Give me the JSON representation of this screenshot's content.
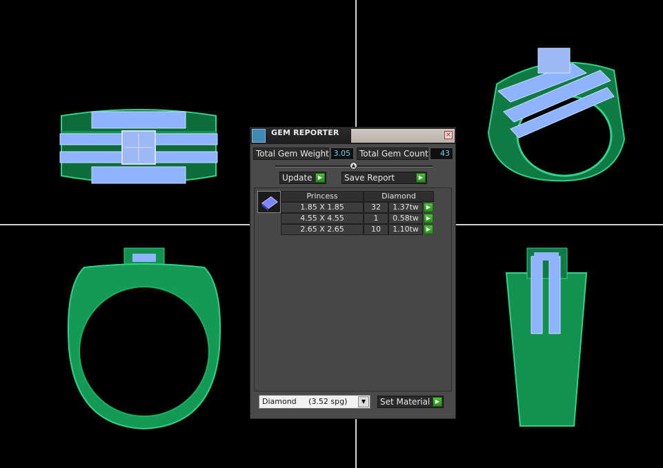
{
  "window": {
    "title": "GEM REPORTER",
    "close_label": "×"
  },
  "totals": {
    "weight_label": "Total Gem Weight",
    "weight_value": "3.05",
    "count_label": "Total Gem Count",
    "count_value": "43"
  },
  "buttons": {
    "update": "Update",
    "save_report": "Save Report",
    "set_material": "Set Material"
  },
  "table": {
    "headers": [
      "Princess",
      "Diamond"
    ],
    "rows": [
      {
        "size": "1.85 X 1.85",
        "count": "32",
        "weight": "1.37tw"
      },
      {
        "size": "4.55 X 4.55",
        "count": "1",
        "weight": "0.58tw"
      },
      {
        "size": "2.65 X 2.65",
        "count": "10",
        "weight": "1.10tw"
      }
    ]
  },
  "material_select": {
    "value": "Diamond     (3.52 spg)"
  },
  "colors": {
    "ring_green": "#1fa060",
    "gem_blue": "#8fb4ff",
    "viewport_bg": "#000000",
    "panel_bg": "#4a4a4a"
  },
  "icons": [
    "gem-reporter-icon",
    "close-icon",
    "arrow-right-icon",
    "slider-knob-icon",
    "princess-gem-icon",
    "chevron-down-icon"
  ]
}
